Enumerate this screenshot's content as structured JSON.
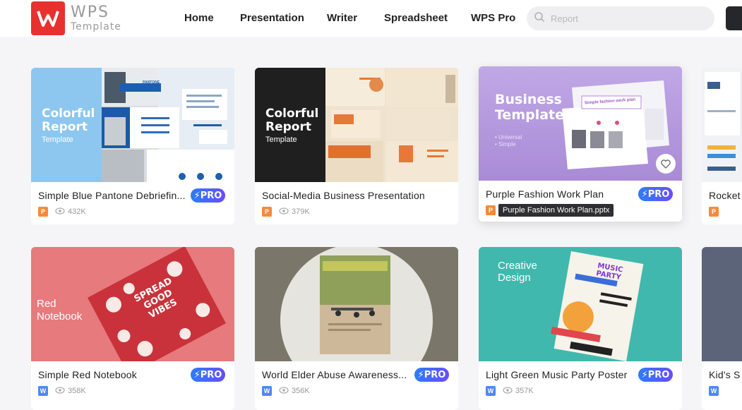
{
  "header": {
    "logo_top": "WPS",
    "logo_bottom": "Template",
    "nav": [
      "Home",
      "Presentation",
      "Writer",
      "Spreadsheet",
      "WPS Pro"
    ],
    "search_placeholder": "Report"
  },
  "cards": [
    {
      "title": "Simple Blue Pantone Debriefin...",
      "badge": "PRO",
      "views": "432K",
      "file_type": "ppt",
      "thumb_heading": "Colorful Report",
      "thumb_sub": "Template",
      "thumb_doc_label": "PANTONE"
    },
    {
      "title": "Social-Media Business Presentation",
      "views": "379K",
      "file_type": "ppt",
      "thumb_heading": "Colorful Report",
      "thumb_sub": "Template"
    },
    {
      "title": "Purple Fashion Work Plan",
      "badge": "PRO",
      "file_type": "ppt",
      "thumb_heading": "Business Template",
      "thumb_bullets": "• Universal\n• Simple",
      "thumb_doc_label": "Simple fashion work plan"
    },
    {
      "title": "Rocket",
      "file_type": "ppt"
    },
    {
      "title": "Simple Red Notebook",
      "badge": "PRO",
      "views": "358K",
      "file_type": "doc",
      "thumb_heading": "Red Notebook",
      "thumb_cover": "SPREAD GOOD VIBES"
    },
    {
      "title": "World Elder Abuse Awareness...",
      "badge": "PRO",
      "views": "356K",
      "file_type": "doc"
    },
    {
      "title": "Light Green Music Party Poster",
      "badge": "PRO",
      "views": "357K",
      "file_type": "doc",
      "thumb_heading": "Creative Design",
      "thumb_poster": "MUSIC PARTY"
    },
    {
      "title": "Kid's S",
      "file_type": "doc"
    }
  ],
  "tooltip": "Purple Fashion Work Plan.pptx",
  "colors": {
    "brand": "#e8312f",
    "pro_start": "#2b7dfc",
    "pro_end": "#6a4cff"
  }
}
